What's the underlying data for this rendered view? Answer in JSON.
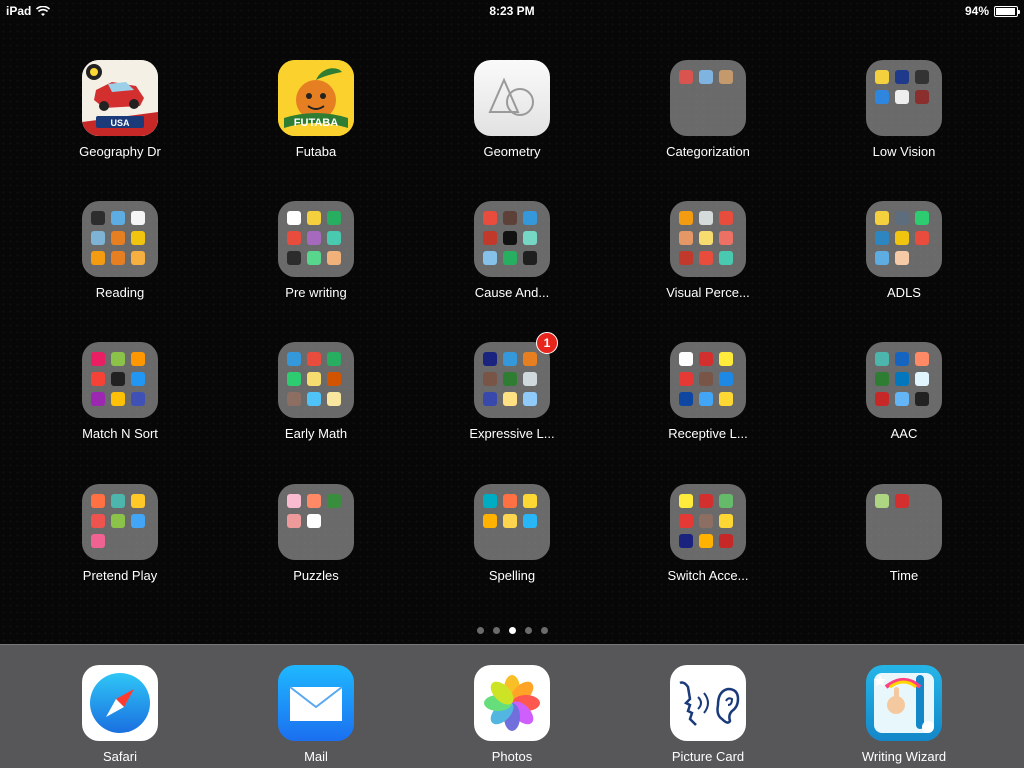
{
  "status_bar": {
    "device": "iPad",
    "time": "8:23 PM",
    "battery": "94%",
    "battery_level": 0.94
  },
  "apps": [
    {
      "label": "Geography Dr",
      "icon": "geography-drive-icon",
      "type": "app"
    },
    {
      "label": "Futaba",
      "icon": "futaba-icon",
      "type": "app"
    },
    {
      "label": "Geometry",
      "icon": "geometry-icon",
      "type": "app"
    },
    {
      "label": "Categorization",
      "type": "folder",
      "colors": [
        "#d9534f",
        "#7fb3e0",
        "#c49a6c"
      ]
    },
    {
      "label": "Low Vision",
      "type": "folder",
      "colors": [
        "#f4d03f",
        "#1f3a8a",
        "#333333",
        "#2e86de",
        "#eeeeee",
        "#8b2e2e"
      ]
    },
    {
      "label": "Reading",
      "type": "folder",
      "colors": [
        "#2d2d2d",
        "#5dade2",
        "#f5f5f5",
        "#7fb3d5",
        "#e67e22",
        "#f1c40f",
        "#f39c12",
        "#e67e22",
        "#f5b041"
      ]
    },
    {
      "label": "Pre writing",
      "type": "folder",
      "colors": [
        "#ffffff",
        "#f4d03f",
        "#27ae60",
        "#e74c3c",
        "#a569bd",
        "#48c9b0",
        "#2c2c2c",
        "#58d68d",
        "#f0b27a"
      ]
    },
    {
      "label": "Cause And...",
      "type": "folder",
      "colors": [
        "#e74c3c",
        "#5d4037",
        "#3498db",
        "#c0392b",
        "#111111",
        "#76d7c4",
        "#85c1e9",
        "#27ae60",
        "#1f1f1f"
      ]
    },
    {
      "label": "Visual Perce...",
      "type": "folder",
      "colors": [
        "#f39c12",
        "#d5dbdb",
        "#e74c3c",
        "#e59866",
        "#f7dc6f",
        "#ec7063",
        "#c0392b",
        "#e74c3c",
        "#48c9b0"
      ]
    },
    {
      "label": "ADLS",
      "type": "folder",
      "colors": [
        "#f4d03f",
        "#5d6d7e",
        "#2ecc71",
        "#2e86c1",
        "#f1c40f",
        "#e74c3c",
        "#5dade2",
        "#f5cba7"
      ]
    },
    {
      "label": "Match N Sort",
      "type": "folder",
      "colors": [
        "#e91e63",
        "#8bc34a",
        "#ff9800",
        "#f44336",
        "#212121",
        "#2196f3",
        "#9c27b0",
        "#ffc107",
        "#3f51b5"
      ]
    },
    {
      "label": "Early Math",
      "type": "folder",
      "colors": [
        "#3498db",
        "#e74c3c",
        "#27ae60",
        "#2ecc71",
        "#f7dc6f",
        "#d35400",
        "#8d6e63",
        "#4fc3f7",
        "#f9e79f"
      ]
    },
    {
      "label": "Expressive L...",
      "type": "folder",
      "badge": "1",
      "colors": [
        "#1a237e",
        "#3498db",
        "#e67e22",
        "#795548",
        "#2e7d32",
        "#cfd8dc",
        "#3949ab",
        "#ffe082",
        "#90caf9"
      ]
    },
    {
      "label": "Receptive L...",
      "type": "folder",
      "colors": [
        "#ffffff",
        "#d32f2f",
        "#ffeb3b",
        "#e53935",
        "#795548",
        "#1e88e5",
        "#0d47a1",
        "#42a5f5",
        "#fdd835"
      ]
    },
    {
      "label": "AAC",
      "type": "folder",
      "colors": [
        "#4db6ac",
        "#1565c0",
        "#ff8a65",
        "#2e7d32",
        "#0277bd",
        "#e1f5fe",
        "#c62828",
        "#64b5f6",
        "#212121"
      ]
    },
    {
      "label": "Pretend Play",
      "type": "folder",
      "colors": [
        "#ff7043",
        "#4db6ac",
        "#ffca28",
        "#ef5350",
        "#8bc34a",
        "#42a5f5",
        "#f06292"
      ]
    },
    {
      "label": "Puzzles",
      "type": "folder",
      "colors": [
        "#f8bbd0",
        "#ff8a65",
        "#388e3c",
        "#ef9a9a",
        "#ffffff"
      ]
    },
    {
      "label": "Spelling",
      "type": "folder",
      "colors": [
        "#00acc1",
        "#ff7043",
        "#fdd835",
        "#ffb300",
        "#ffd54f",
        "#29b6f6"
      ]
    },
    {
      "label": "Switch Acce...",
      "type": "folder",
      "colors": [
        "#ffeb3b",
        "#d32f2f",
        "#66bb6a",
        "#e53935",
        "#8d6e63",
        "#fdd835",
        "#1a237e",
        "#ffb300",
        "#c62828"
      ]
    },
    {
      "label": "Time",
      "type": "folder",
      "colors": [
        "#aed581",
        "#d32f2f"
      ]
    }
  ],
  "page_dots": {
    "count": 5,
    "active_index": 2
  },
  "dock": [
    {
      "label": "Safari",
      "icon": "safari-compass-icon"
    },
    {
      "label": "Mail",
      "icon": "mail-envelope-icon"
    },
    {
      "label": "Photos",
      "icon": "photos-flower-icon"
    },
    {
      "label": "Picture Card",
      "icon": "picture-card-speech-icon"
    },
    {
      "label": "Writing Wizard",
      "icon": "writing-wizard-icon"
    }
  ]
}
